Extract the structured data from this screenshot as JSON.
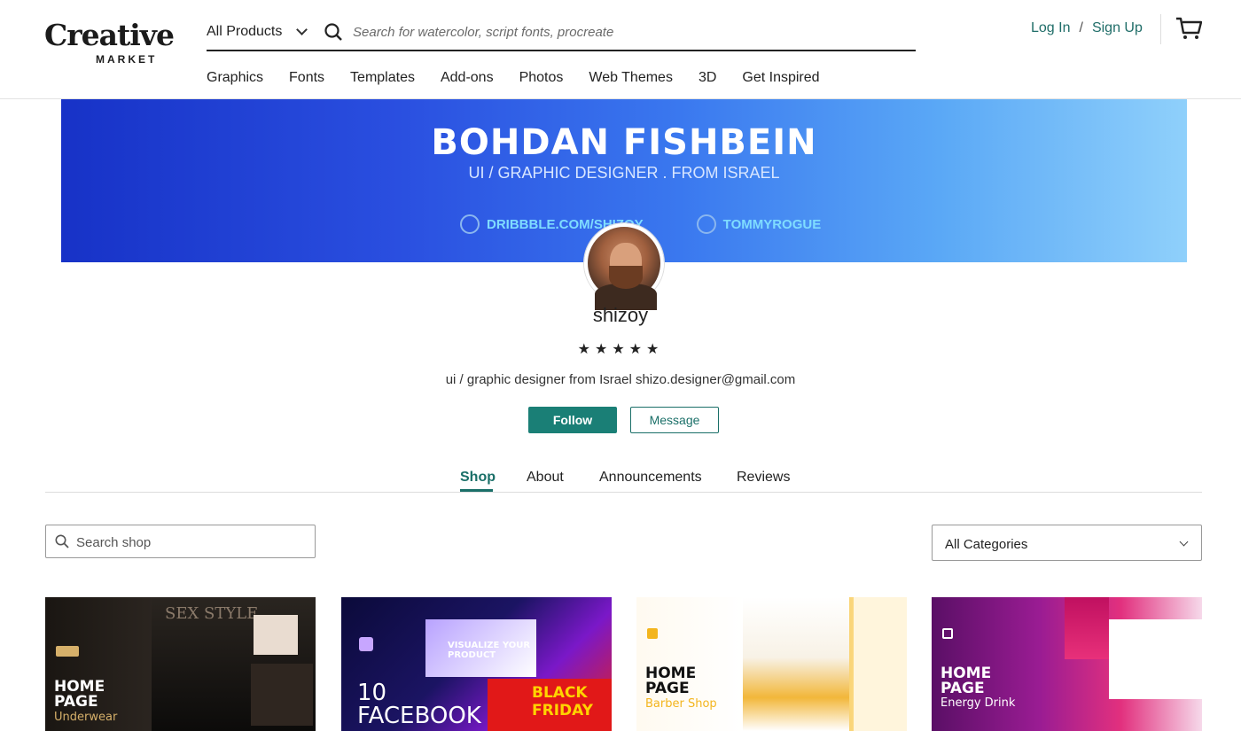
{
  "header": {
    "logo_main": "Creative",
    "logo_sub": "MARKET",
    "product_select": "All Products",
    "search_placeholder": "Search for watercolor, script fonts, procreate",
    "nav": [
      "Graphics",
      "Fonts",
      "Templates",
      "Add-ons",
      "Photos",
      "Web Themes",
      "3D",
      "Get Inspired"
    ],
    "login": "Log In",
    "separator": "/",
    "signup": "Sign Up"
  },
  "banner": {
    "title": "BOHDAN FISHBEIN",
    "subtitle": "UI / GRAPHIC DESIGNER . FROM ISRAEL",
    "link1": "DRIBBBLE.COM/SHIZOY",
    "link2": "TOMMYROGUE"
  },
  "profile": {
    "username": "shizoy",
    "rating_stars": "★★★★★",
    "rating": 5,
    "bio": "ui / graphic designer from Israel shizo.designer@gmail.com",
    "follow_label": "Follow",
    "message_label": "Message"
  },
  "tabs": {
    "items": [
      "Shop",
      "About",
      "Announcements",
      "Reviews"
    ],
    "active": "Shop"
  },
  "shop": {
    "search_placeholder": "Search shop",
    "category_select": "All Categories"
  },
  "products": [
    {
      "line1": "HOME",
      "line2": "PAGE",
      "line3": "Underwear",
      "deco": "SEX STYLE"
    },
    {
      "line1": "10",
      "line2": "FACEBOOK",
      "deco": "BLACK FRIDAY",
      "deco2": "VISUALIZE YOUR PRODUCT"
    },
    {
      "line1": "HOME",
      "line2": "PAGE",
      "line3": "Barber Shop"
    },
    {
      "line1": "HOME",
      "line2": "PAGE",
      "line3": "Energy Drink"
    }
  ],
  "colors": {
    "accent": "#1a7f76",
    "link": "#1f6d68",
    "banner_start": "#1732c7",
    "banner_end": "#8fd0fb"
  }
}
